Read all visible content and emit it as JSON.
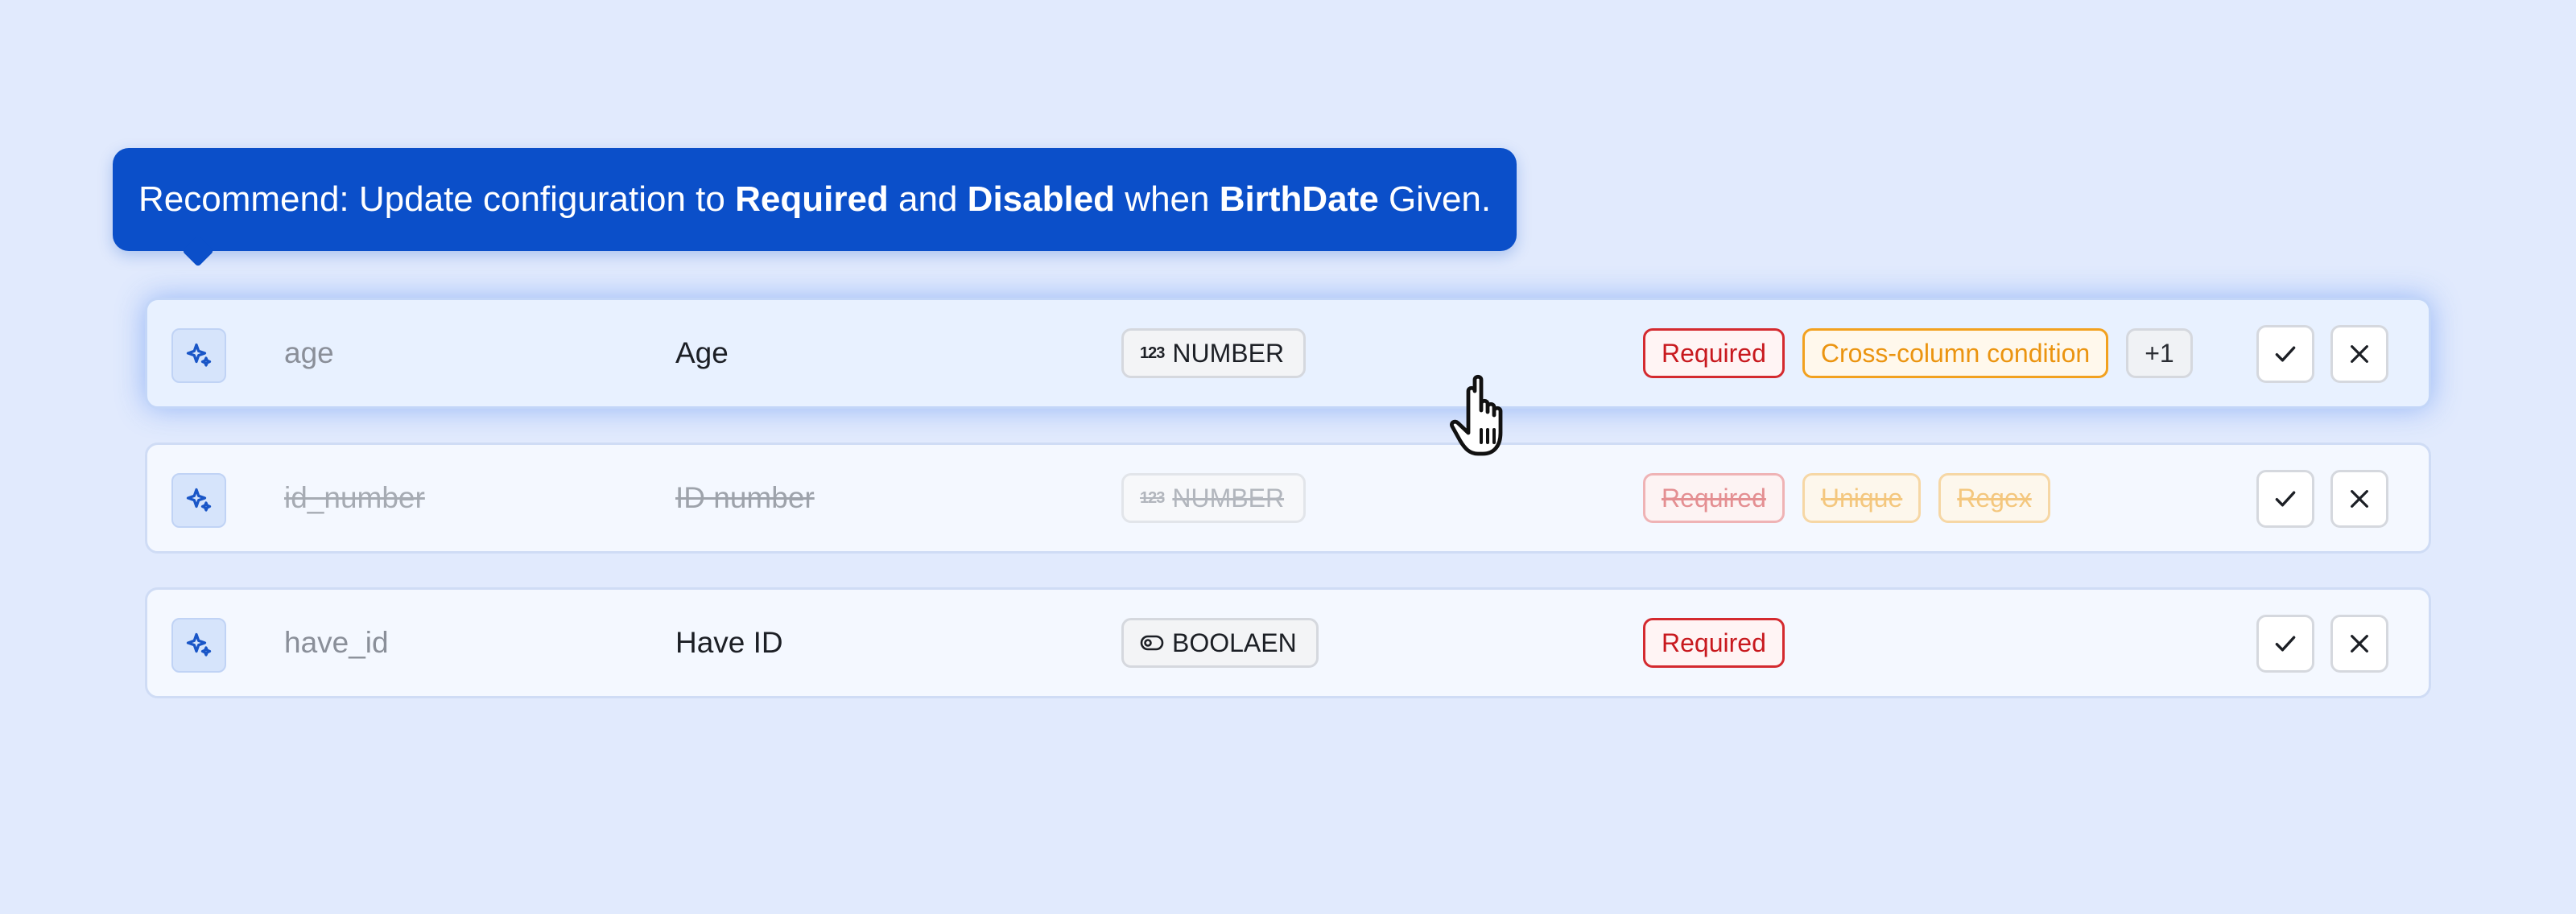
{
  "tooltip": {
    "part1": "Recommend: Update configuration to ",
    "bold1": "Required",
    "part2": " and ",
    "bold2": "Disabled",
    "part3": " when ",
    "bold3": "BirthDate",
    "part4": " Given."
  },
  "rows": [
    {
      "key": "age",
      "label": "Age",
      "type_icon": "123",
      "type": "NUMBER",
      "tags": [
        "Required",
        "Cross-column condition",
        "+1"
      ],
      "state": "active"
    },
    {
      "key": "id_number",
      "label": "ID number",
      "type_icon": "123",
      "type": "NUMBER",
      "tags": [
        "Required",
        "Unique",
        "Regex"
      ],
      "state": "struck-through"
    },
    {
      "key": "have_id",
      "label": "Have ID",
      "type_icon": "toggle-icon",
      "type": "BOOLAEN",
      "tags": [
        "Required"
      ],
      "state": "normal"
    }
  ],
  "icons": {
    "row_badge": "sparkle-icon",
    "accept": "check-icon",
    "reject": "close-icon",
    "pointer": "hand-pointer-cursor-icon"
  },
  "colors": {
    "background": "#e1eafd",
    "tooltip": "#0b4fc9",
    "required": "#c8191e",
    "condition": "#eb9410",
    "accent": "#1a56c7"
  }
}
